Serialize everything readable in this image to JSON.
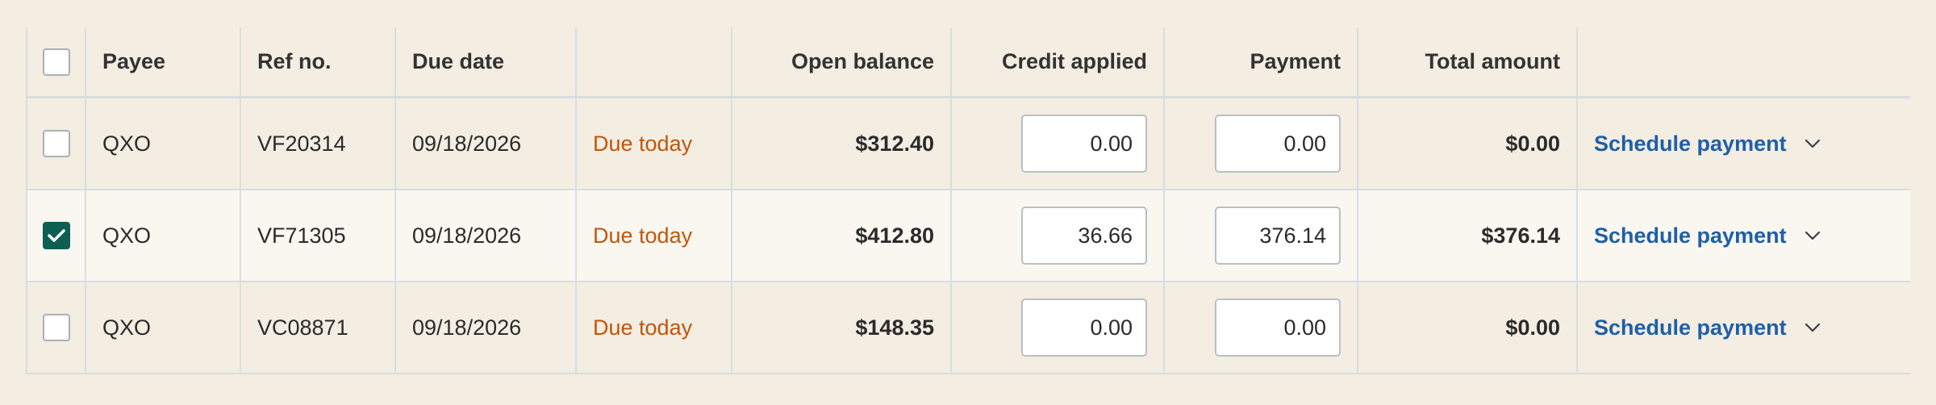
{
  "header": {
    "select_all_checked": false,
    "payee": "Payee",
    "ref_no": "Ref no.",
    "due_date": "Due date",
    "status": "",
    "open_balance": "Open balance",
    "credit_applied": "Credit applied",
    "payment": "Payment",
    "total_amount": "Total amount"
  },
  "rows": [
    {
      "checked": false,
      "payee": "QXO",
      "ref_no": "VF20314",
      "due_date": "09/18/2026",
      "status": "Due today",
      "open_balance": "$312.40",
      "credit_applied": "0.00",
      "payment": "0.00",
      "total_amount": "$0.00",
      "action": "Schedule payment"
    },
    {
      "checked": true,
      "payee": "QXO",
      "ref_no": "VF71305",
      "due_date": "09/18/2026",
      "status": "Due today",
      "open_balance": "$412.80",
      "credit_applied": "36.66",
      "payment": "376.14",
      "total_amount": "$376.14",
      "action": "Schedule payment"
    },
    {
      "checked": false,
      "payee": "QXO",
      "ref_no": "VC08871",
      "due_date": "09/18/2026",
      "status": "Due today",
      "open_balance": "$148.35",
      "credit_applied": "0.00",
      "payment": "0.00",
      "total_amount": "$0.00",
      "action": "Schedule payment"
    }
  ],
  "colors": {
    "background": "#f3ede2",
    "selected_row": "#faf7f1",
    "status_due": "#c2560a",
    "link": "#1f5fa8",
    "checkbox_checked": "#0c5f52",
    "border": "#d9dee0"
  },
  "icons": {
    "checkmark": "check-icon",
    "row_menu": "chevron-down-icon"
  }
}
